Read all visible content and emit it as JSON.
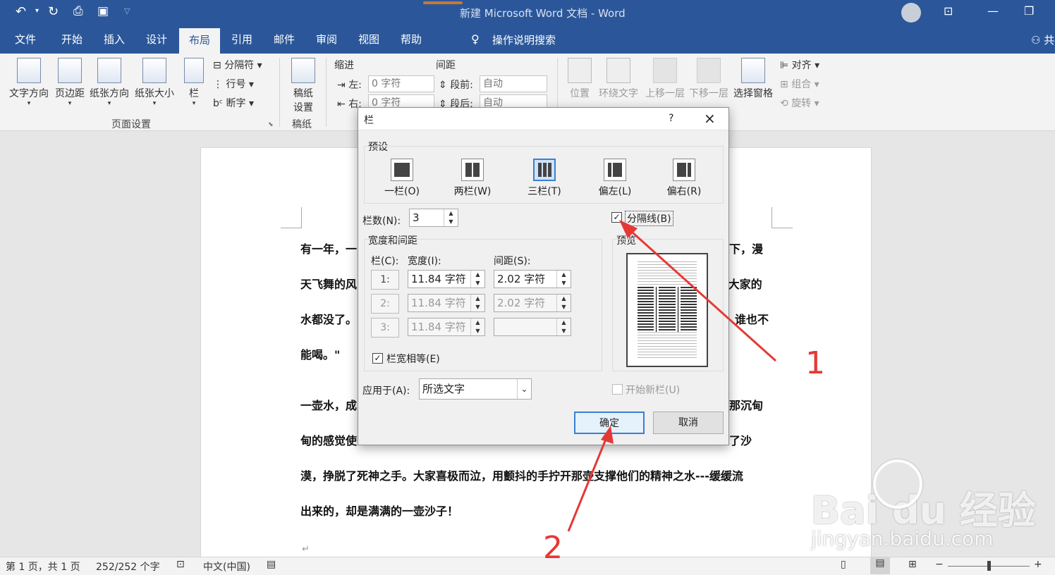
{
  "titlebar": {
    "title": "新建 Microsoft Word 文档  -  Word"
  },
  "tabs": [
    "文件",
    "开始",
    "插入",
    "设计",
    "布局",
    "引用",
    "邮件",
    "审阅",
    "视图",
    "帮助"
  ],
  "search_label": "操作说明搜索",
  "share_label": "共",
  "ribbon": {
    "page_setup": {
      "text_dir": "文字方向",
      "margins": "页边距",
      "orientation": "纸张方向",
      "size": "纸张大小",
      "columns": "栏",
      "breaks": "分隔符",
      "line_numbers": "行号",
      "hyphenation": "断字",
      "group": "页面设置"
    },
    "manuscript": {
      "label1": "稿纸",
      "label2": "设置",
      "group": "稿纸"
    },
    "indent": {
      "title": "缩进",
      "left_label": "左:",
      "left_value": "0 字符",
      "right_label": "右:",
      "right_value": "0 字符"
    },
    "spacing": {
      "title": "间距",
      "before_label": "段前:",
      "before_value": "自动",
      "after_label": "段后:",
      "after_value": "自动"
    },
    "arrange": {
      "position": "位置",
      "wrap": "环绕文字",
      "forward": "上移一层",
      "backward": "下移一层",
      "selection_pane": "选择窗格",
      "align": "对齐",
      "group": "组合",
      "rotate": "旋转"
    }
  },
  "document": {
    "lines": [
      "有一年，一",
      "天飞舞的风",
      "水都没了。",
      "能喝。\"",
      "一壶水，成",
      "甸的感觉使",
      "漠，挣脱了死神之手。大家喜极而泣，用颤抖的手拧开那壶支撑他们的精神之水---缓缓流",
      "出来的，却是满满的一壶沙子！"
    ],
    "right_fragments": [
      "下，漫",
      "-大家的",
      "谁也不",
      "那沉甸",
      "了沙"
    ]
  },
  "dialog": {
    "title": "栏",
    "help": "?",
    "presets_title": "预设",
    "presets": [
      "一栏(O)",
      "两栏(W)",
      "三栏(T)",
      "偏左(L)",
      "偏右(R)"
    ],
    "num_cols_label": "栏数(N):",
    "num_cols_value": "3",
    "line_between_label": "分隔线(B)",
    "line_between_checked": true,
    "width_spacing_title": "宽度和间距",
    "col_header": "栏(C):",
    "width_header": "宽度(I):",
    "spacing_header": "间距(S):",
    "preview_title": "预览",
    "rows": [
      {
        "num": "1:",
        "width": "11.84 字符",
        "spacing": "2.02 字符"
      },
      {
        "num": "2:",
        "width": "11.84 字符",
        "spacing": "2.02 字符"
      },
      {
        "num": "3:",
        "width": "11.84 字符",
        "spacing": ""
      }
    ],
    "equal_width_label": "栏宽相等(E)",
    "apply_label": "应用于(A):",
    "apply_value": "所选文字",
    "start_new_label": "开始新栏(U)",
    "ok": "确定",
    "cancel": "取消"
  },
  "status": {
    "page": "第 1 页，共 1 页",
    "words": "252/252 个字",
    "lang": "中文(中国)",
    "zoom_minus": "−",
    "zoom_plus": "+"
  },
  "annotations": {
    "one": "1",
    "two": "2"
  },
  "watermark": {
    "brand": "Bai du 经验",
    "url": "jingyan.baidu.com"
  }
}
